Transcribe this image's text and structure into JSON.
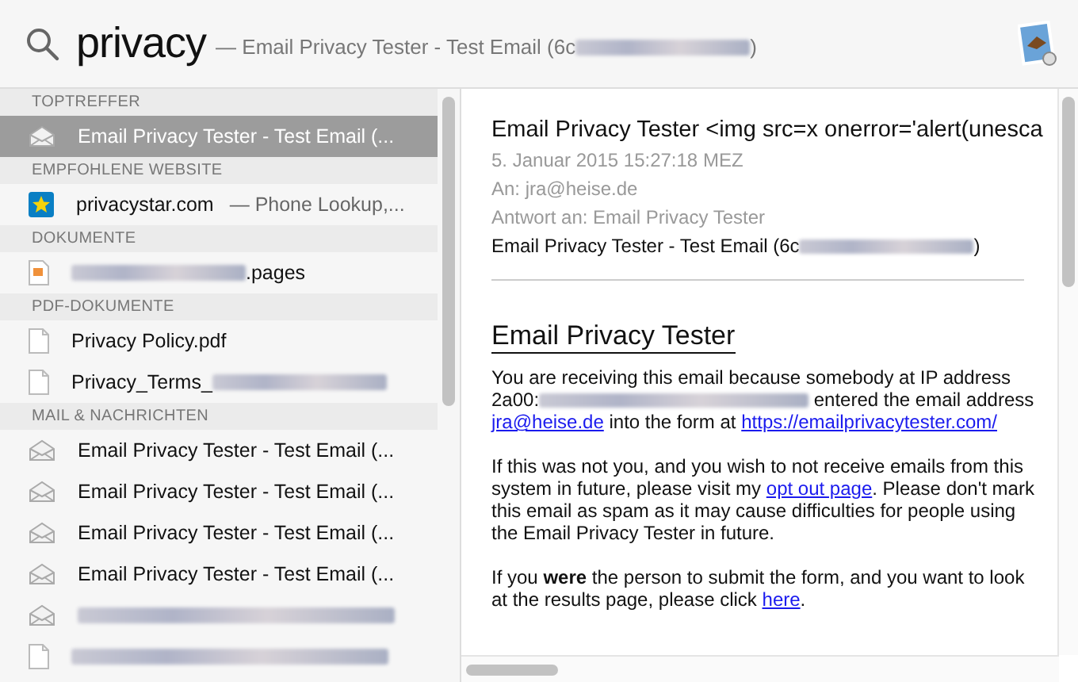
{
  "search": {
    "query": "privacy",
    "completion": [
      {
        "kind": "text",
        "text": "— Email Privacy Tester - Test Email (6c"
      },
      {
        "kind": "redacted"
      },
      {
        "kind": "text",
        "text": ")"
      }
    ]
  },
  "sections": [
    {
      "title": "TOPTREFFER",
      "rows": [
        {
          "kind": "mail",
          "selected": true,
          "parts": [
            {
              "kind": "text",
              "text": "Email Privacy Tester - Test Email (..."
            }
          ]
        }
      ]
    },
    {
      "title": "EMPFOHLENE WEBSITE",
      "rows": [
        {
          "kind": "star",
          "selected": false,
          "parts": [
            {
              "kind": "text",
              "text": "privacystar.com"
            },
            {
              "kind": "sub",
              "text": "— Phone Lookup,..."
            }
          ]
        }
      ]
    },
    {
      "title": "DOKUMENTE",
      "rows": [
        {
          "kind": "pages",
          "selected": false,
          "parts": [
            {
              "kind": "redacted"
            },
            {
              "kind": "text",
              "text": ".pages"
            }
          ]
        }
      ]
    },
    {
      "title": "PDF-DOKUMENTE",
      "rows": [
        {
          "kind": "doc",
          "selected": false,
          "parts": [
            {
              "kind": "text",
              "text": "Privacy Policy.pdf"
            }
          ]
        },
        {
          "kind": "doc",
          "selected": false,
          "parts": [
            {
              "kind": "text",
              "text": "Privacy_Terms_"
            },
            {
              "kind": "redacted"
            }
          ]
        }
      ]
    },
    {
      "title": "MAIL & NACHRICHTEN",
      "rows": [
        {
          "kind": "mail",
          "selected": false,
          "parts": [
            {
              "kind": "text",
              "text": "Email Privacy Tester - Test Email (..."
            }
          ]
        },
        {
          "kind": "mail",
          "selected": false,
          "parts": [
            {
              "kind": "text",
              "text": "Email Privacy Tester - Test Email (..."
            }
          ]
        },
        {
          "kind": "mail",
          "selected": false,
          "parts": [
            {
              "kind": "text",
              "text": "Email Privacy Tester - Test Email (..."
            }
          ]
        },
        {
          "kind": "mail",
          "selected": false,
          "parts": [
            {
              "kind": "text",
              "text": "Email Privacy Tester - Test Email (..."
            }
          ]
        },
        {
          "kind": "mail",
          "selected": false,
          "parts": [
            {
              "kind": "redacted"
            }
          ]
        },
        {
          "kind": "doc",
          "selected": false,
          "parts": [
            {
              "kind": "redacted"
            }
          ]
        }
      ]
    }
  ],
  "preview": {
    "subject": "Email Privacy Tester <img src=x onerror='alert(unesca",
    "date": "5. Januar 2015 15:27:18 MEZ",
    "to": "An: jra@heise.de",
    "reply_to": "Antwort an: Email Privacy Tester",
    "summary": [
      {
        "kind": "text",
        "text": "Email Privacy Tester - Test Email (6c"
      },
      {
        "kind": "redacted"
      },
      {
        "kind": "text",
        "text": ")"
      }
    ],
    "heading": "Email Privacy Tester",
    "paragraphs": [
      [
        {
          "kind": "text",
          "text": "You are receiving this email because somebody at IP address 2a00:"
        },
        {
          "kind": "redacted"
        },
        {
          "kind": "text",
          "text": " entered the email address "
        },
        {
          "kind": "link",
          "text": "jra@heise.de"
        },
        {
          "kind": "text",
          "text": " into the form at "
        },
        {
          "kind": "link",
          "text": "https://emailprivacytester.com/"
        }
      ],
      [
        {
          "kind": "text",
          "text": "If this was not you, and you wish to not receive emails from this system in future, please visit my "
        },
        {
          "kind": "link",
          "text": "opt out page"
        },
        {
          "kind": "text",
          "text": ". Please don't mark this email as spam as it may cause difficulties for people using the Email Privacy Tester in future."
        }
      ],
      [
        {
          "kind": "text",
          "text": "If you "
        },
        {
          "kind": "bold",
          "text": "were"
        },
        {
          "kind": "text",
          "text": " the person to submit the form, and you want to look at the results page, please click "
        },
        {
          "kind": "link",
          "text": "here"
        },
        {
          "kind": "text",
          "text": "."
        }
      ]
    ]
  }
}
